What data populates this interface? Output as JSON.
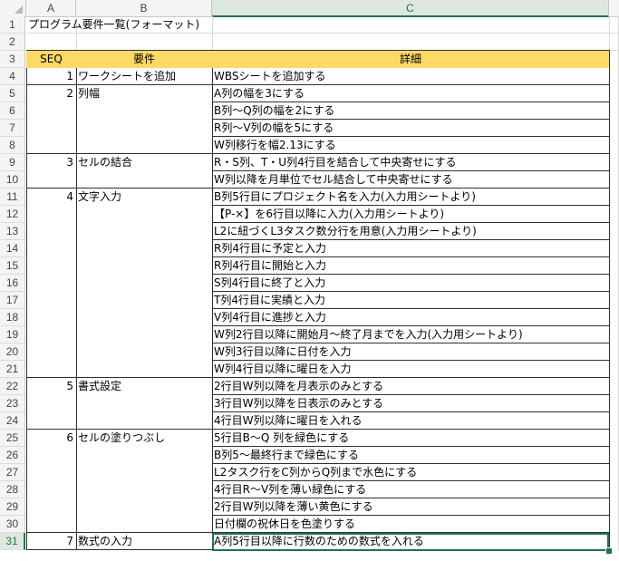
{
  "columns": [
    "A",
    "B",
    "C"
  ],
  "active": {
    "column": "C",
    "row": 31
  },
  "rows": [
    {
      "n": 1,
      "seq": "",
      "req": "プログラム要件一覧(フォーマット)",
      "detail": ""
    },
    {
      "n": 2,
      "seq": "",
      "req": "",
      "detail": ""
    },
    {
      "n": 3,
      "seq": "SEQ",
      "req": "要件",
      "detail": "詳細"
    },
    {
      "n": 4,
      "seq": "1",
      "req": "ワークシートを追加",
      "detail": "WBSシートを追加する"
    },
    {
      "n": 5,
      "seq": "2",
      "req": "列幅",
      "detail": "A列の幅を3にする"
    },
    {
      "n": 6,
      "seq": "",
      "req": "",
      "detail": "B列～Q列の幅を2にする"
    },
    {
      "n": 7,
      "seq": "",
      "req": "",
      "detail": "R列～V列の幅を5にする"
    },
    {
      "n": 8,
      "seq": "",
      "req": "",
      "detail": "W列移行を幅2.13にする"
    },
    {
      "n": 9,
      "seq": "3",
      "req": "セルの結合",
      "detail": "R・S列、T・U列4行目を結合して中央寄せにする"
    },
    {
      "n": 10,
      "seq": "",
      "req": "",
      "detail": "W列以降を月単位でセル結合して中央寄せにする"
    },
    {
      "n": 11,
      "seq": "4",
      "req": "文字入力",
      "detail": "B列5行目にプロジェクト名を入力(入力用シートより)"
    },
    {
      "n": 12,
      "seq": "",
      "req": "",
      "detail": "【P-×】を6行目以降に入力(入力用シートより)"
    },
    {
      "n": 13,
      "seq": "",
      "req": "",
      "detail": "L2に紐づくL3タスク数分行を用意(入力用シートより)"
    },
    {
      "n": 14,
      "seq": "",
      "req": "",
      "detail": "R列4行目に予定と入力"
    },
    {
      "n": 15,
      "seq": "",
      "req": "",
      "detail": "R列4行目に開始と入力"
    },
    {
      "n": 16,
      "seq": "",
      "req": "",
      "detail": "S列4行目に終了と入力"
    },
    {
      "n": 17,
      "seq": "",
      "req": "",
      "detail": "T列4行目に実績と入力"
    },
    {
      "n": 18,
      "seq": "",
      "req": "",
      "detail": "V列4行目に進捗と入力"
    },
    {
      "n": 19,
      "seq": "",
      "req": "",
      "detail": "W列2行目以降に開始月～終了月までを入力(入力用シートより)"
    },
    {
      "n": 20,
      "seq": "",
      "req": "",
      "detail": "W列3行目以降に日付を入力"
    },
    {
      "n": 21,
      "seq": "",
      "req": "",
      "detail": "W列4行目以降に曜日を入力"
    },
    {
      "n": 22,
      "seq": "5",
      "req": "書式設定",
      "detail": "2行目W列以降を月表示のみとする"
    },
    {
      "n": 23,
      "seq": "",
      "req": "",
      "detail": "3行目W列以降を日表示のみとする"
    },
    {
      "n": 24,
      "seq": "",
      "req": "",
      "detail": "4行目W列以降に曜日を入れる"
    },
    {
      "n": 25,
      "seq": "6",
      "req": "セルの塗りつぶし",
      "detail": "5行目B～Q 列を緑色にする"
    },
    {
      "n": 26,
      "seq": "",
      "req": "",
      "detail": "B列5～最終行まで緑色にする"
    },
    {
      "n": 27,
      "seq": "",
      "req": "",
      "detail": "L2タスク行をC列からQ列まで水色にする"
    },
    {
      "n": 28,
      "seq": "",
      "req": "",
      "detail": "4行目R～V列を薄い緑色にする"
    },
    {
      "n": 29,
      "seq": "",
      "req": "",
      "detail": "2行目W列以降を薄い黄色にする"
    },
    {
      "n": 30,
      "seq": "",
      "req": "",
      "detail": "日付欄の祝休日を色塗りする"
    },
    {
      "n": 31,
      "seq": "7",
      "req": "数式の入力",
      "detail": "A列5行目以降に行数のための数式を入れる"
    }
  ],
  "colors": {
    "header_fill": "#ffd966",
    "selection": "#217346"
  }
}
